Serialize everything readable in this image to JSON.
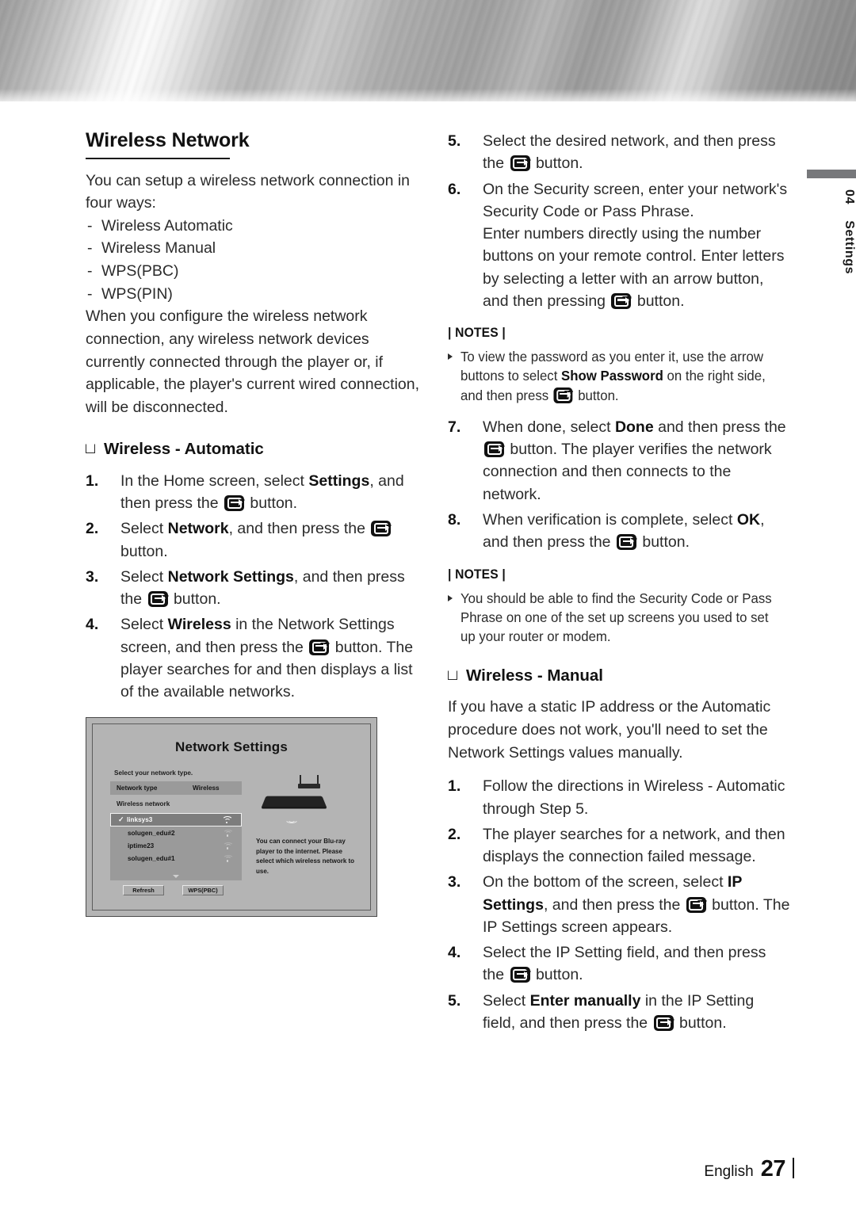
{
  "header": {
    "banner_style": "brushed-metal-diagonal",
    "accent_color": "#77787b"
  },
  "side_tab": {
    "number": "04",
    "label": "Settings"
  },
  "left_column": {
    "section_title": "Wireless Network",
    "intro": "You can setup a wireless network connection in four ways:",
    "methods": [
      "Wireless Automatic",
      "Wireless Manual",
      "WPS(PBC)",
      "WPS(PIN)"
    ],
    "note_paragraph": "When you configure the wireless network connection, any wireless network devices currently connected through the player or, if applicable, the player's current wired connection, will be disconnected.",
    "subheading": "Wireless - Automatic",
    "steps": [
      {
        "num": "1.",
        "parts": [
          {
            "t": "In the Home screen, select "
          },
          {
            "t": "Settings",
            "b": true
          },
          {
            "t": ", and then press the "
          },
          {
            "icon": "enter-button-icon"
          },
          {
            "t": " button."
          }
        ]
      },
      {
        "num": "2.",
        "parts": [
          {
            "t": "Select "
          },
          {
            "t": "Network",
            "b": true
          },
          {
            "t": ", and then press the "
          },
          {
            "icon": "enter-button-icon"
          },
          {
            "t": " button."
          }
        ]
      },
      {
        "num": "3.",
        "parts": [
          {
            "t": "Select "
          },
          {
            "t": "Network Settings",
            "b": true
          },
          {
            "t": ", and then press the "
          },
          {
            "icon": "enter-button-icon"
          },
          {
            "t": " button."
          }
        ]
      },
      {
        "num": "4.",
        "parts": [
          {
            "t": "Select "
          },
          {
            "t": "Wireless",
            "b": true
          },
          {
            "t": " in the Network Settings screen, and then press the "
          },
          {
            "icon": "enter-button-icon"
          },
          {
            "t": " button. The player searches for and then displays a list of the available networks."
          }
        ]
      }
    ]
  },
  "screenshot": {
    "title": "Network Settings",
    "subtitle": "Select your network type.",
    "network_type_key": "Network type",
    "network_type_value": "Wireless",
    "wireless_network_label": "Wireless network",
    "networks": [
      {
        "name": "linksys3",
        "selected": true,
        "signal": "full"
      },
      {
        "name": "solugen_edu#2",
        "selected": false,
        "signal": "weak"
      },
      {
        "name": "iptime23",
        "selected": false,
        "signal": "weak"
      },
      {
        "name": "solugen_edu#1",
        "selected": false,
        "signal": "weak"
      }
    ],
    "buttons": [
      "Refresh",
      "WPS(PBC)"
    ],
    "description": "You can connect your Blu-ray player to the internet. Please select which wireless network to use."
  },
  "right_column": {
    "steps_continued": [
      {
        "num": "5.",
        "parts": [
          {
            "t": "Select the desired network, and then press the "
          },
          {
            "icon": "enter-button-icon"
          },
          {
            "t": " button."
          }
        ]
      },
      {
        "num": "6.",
        "parts": [
          {
            "t": "On the Security screen, enter your network's Security Code or Pass Phrase."
          },
          {
            "br": true
          },
          {
            "t": "Enter numbers directly using the number buttons on your remote control. Enter letters by selecting a letter with an arrow button, and then pressing "
          },
          {
            "icon": "enter-button-icon"
          },
          {
            "t": " button."
          }
        ]
      }
    ],
    "notes_1": {
      "heading": "| NOTES |",
      "items": [
        [
          {
            "t": "To view the password as you enter it, use the arrow buttons to select "
          },
          {
            "t": "Show Password",
            "b": true
          },
          {
            "t": " on the right side, and then press "
          },
          {
            "icon": "enter-button-icon"
          },
          {
            "t": " button."
          }
        ]
      ]
    },
    "steps_continued_2": [
      {
        "num": "7.",
        "parts": [
          {
            "t": "When done, select "
          },
          {
            "t": "Done",
            "b": true
          },
          {
            "t": " and then press the "
          },
          {
            "icon": "enter-button-icon"
          },
          {
            "t": " button. The player verifies the network connection and then connects to the network."
          }
        ]
      },
      {
        "num": "8.",
        "parts": [
          {
            "t": "When verification is complete, select "
          },
          {
            "t": "OK",
            "b": true
          },
          {
            "t": ", and then press the "
          },
          {
            "icon": "enter-button-icon"
          },
          {
            "t": " button."
          }
        ]
      }
    ],
    "notes_2": {
      "heading": "| NOTES |",
      "items": [
        [
          {
            "t": "You should be able to find the Security Code or Pass Phrase on one of the set up screens you used to set up your router or modem."
          }
        ]
      ]
    },
    "subheading": "Wireless - Manual",
    "manual_intro": "If you have a static IP address or the Automatic procedure does not work, you'll need to set the Network Settings values manually.",
    "manual_steps": [
      {
        "num": "1.",
        "parts": [
          {
            "t": "Follow the directions in Wireless - Automatic through Step 5."
          }
        ]
      },
      {
        "num": "2.",
        "parts": [
          {
            "t": "The player searches for a network, and then displays the connection failed message."
          }
        ]
      },
      {
        "num": "3.",
        "parts": [
          {
            "t": "On the bottom of the screen, select "
          },
          {
            "t": "IP Settings",
            "b": true
          },
          {
            "t": ", and then press the "
          },
          {
            "icon": "enter-button-icon"
          },
          {
            "t": " button. The IP Settings screen appears."
          }
        ]
      },
      {
        "num": "4.",
        "parts": [
          {
            "t": "Select the IP Setting field, and then press the "
          },
          {
            "icon": "enter-button-icon"
          },
          {
            "t": " button."
          }
        ]
      },
      {
        "num": "5.",
        "parts": [
          {
            "t": "Select "
          },
          {
            "t": "Enter manually",
            "b": true
          },
          {
            "t": " in the IP Setting field, and then press the "
          },
          {
            "icon": "enter-button-icon"
          },
          {
            "t": " button."
          }
        ]
      }
    ]
  },
  "footer": {
    "language": "English",
    "page_number": "27"
  }
}
